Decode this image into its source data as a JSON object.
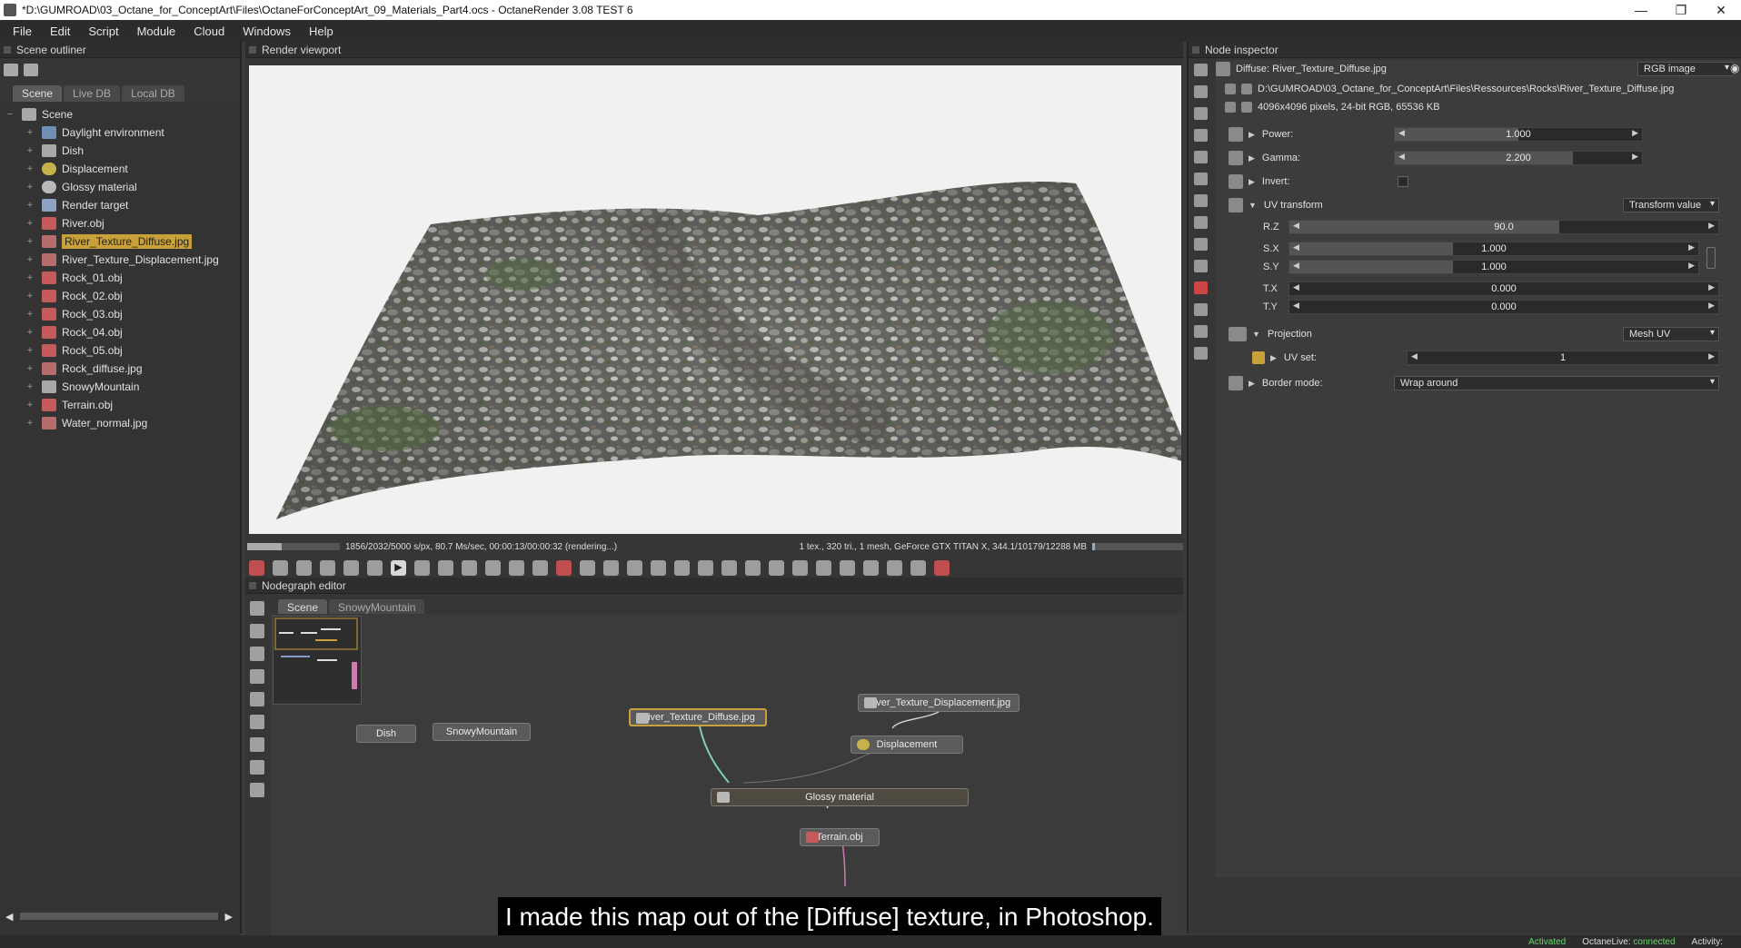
{
  "window": {
    "title": "*D:\\GUMROAD\\03_Octane_for_ConceptArt\\Files\\OctaneForConceptArt_09_Materials_Part4.ocs - OctaneRender 3.08 TEST 6",
    "minimize": "—",
    "restore": "❐",
    "close": "✕"
  },
  "menu": [
    "File",
    "Edit",
    "Script",
    "Module",
    "Cloud",
    "Windows",
    "Help"
  ],
  "outliner": {
    "title": "Scene outliner",
    "tabs": [
      "Scene",
      "Live DB",
      "Local DB"
    ],
    "root": "Scene",
    "items": [
      {
        "label": "Daylight environment",
        "icon": "environment-icon"
      },
      {
        "label": "Dish",
        "icon": "geometry-icon"
      },
      {
        "label": "Displacement",
        "icon": "displacement-icon"
      },
      {
        "label": "Glossy material",
        "icon": "material-icon"
      },
      {
        "label": "Render target",
        "icon": "render-target-icon"
      },
      {
        "label": "River.obj",
        "icon": "mesh-icon"
      },
      {
        "label": "River_Texture_Diffuse.jpg",
        "icon": "image-icon",
        "selected": true
      },
      {
        "label": "River_Texture_Displacement.jpg",
        "icon": "image-icon"
      },
      {
        "label": "Rock_01.obj",
        "icon": "mesh-icon"
      },
      {
        "label": "Rock_02.obj",
        "icon": "mesh-icon"
      },
      {
        "label": "Rock_03.obj",
        "icon": "mesh-icon"
      },
      {
        "label": "Rock_04.obj",
        "icon": "mesh-icon"
      },
      {
        "label": "Rock_05.obj",
        "icon": "mesh-icon"
      },
      {
        "label": "Rock_diffuse.jpg",
        "icon": "image-icon"
      },
      {
        "label": "SnowyMountain",
        "icon": "geometry-icon"
      },
      {
        "label": "Terrain.obj",
        "icon": "mesh-icon"
      },
      {
        "label": "Water_normal.jpg",
        "icon": "image-icon"
      }
    ]
  },
  "viewport": {
    "title": "Render viewport",
    "status_left": "1856/2032/5000 s/px, 80.7 Ms/sec, 00:00:13/00:00:32 (rendering...)",
    "status_right": "1 tex., 320 tri., 1 mesh, GeForce GTX TITAN X, 344.1/10179/12288 MB",
    "progress_fraction": 0.37,
    "vram_fraction": 0.03
  },
  "nodegraph": {
    "title": "Nodegraph editor",
    "tabs": [
      "Scene",
      "SnowyMountain"
    ],
    "nodes": {
      "dish": "Dish",
      "snowy": "SnowyMountain",
      "diffuse": "River_Texture_Diffuse.jpg",
      "displacement_tex": "River_Texture_Displacement.jpg",
      "displacement": "Displacement",
      "glossy": "Glossy material",
      "terrain": "Terrain.obj"
    }
  },
  "inspector": {
    "title": "Node inspector",
    "node_name": "Diffuse: River_Texture_Diffuse.jpg",
    "node_type": "RGB image",
    "file_path": "D:\\GUMROAD\\03_Octane_for_ConceptArt\\Files\\Ressources\\Rocks\\River_Texture_Diffuse.jpg",
    "file_info": "4096x4096 pixels, 24-bit RGB, 65536 KB",
    "power": {
      "label": "Power:",
      "value": "1.000",
      "fraction": 0.5
    },
    "gamma": {
      "label": "Gamma:",
      "value": "2.200",
      "fraction": 0.72
    },
    "invert": {
      "label": "Invert:"
    },
    "uv_transform": {
      "label": "UV transform",
      "mode": "Transform value"
    },
    "rz": {
      "label": "R.Z",
      "value": "90.0",
      "fraction": 0.63
    },
    "sx": {
      "label": "S.X",
      "value": "1.000",
      "fraction": 0.4
    },
    "sy": {
      "label": "S.Y",
      "value": "1.000",
      "fraction": 0.4
    },
    "tx": {
      "label": "T.X",
      "value": "0.000",
      "fraction": 0.0
    },
    "ty": {
      "label": "T.Y",
      "value": "0.000",
      "fraction": 0.0
    },
    "projection": {
      "label": "Projection",
      "mode": "Mesh UV"
    },
    "uv_set": {
      "label": "UV set:",
      "value": "1"
    },
    "border_mode": {
      "label": "Border mode:",
      "value": "Wrap around"
    }
  },
  "subtitle": "I made this map out of the [Diffuse] texture, in Photoshop.",
  "statusbar": {
    "activated": "Activated",
    "live_label": "OctaneLive:",
    "live_status": "connected",
    "activity": "Activity:"
  }
}
